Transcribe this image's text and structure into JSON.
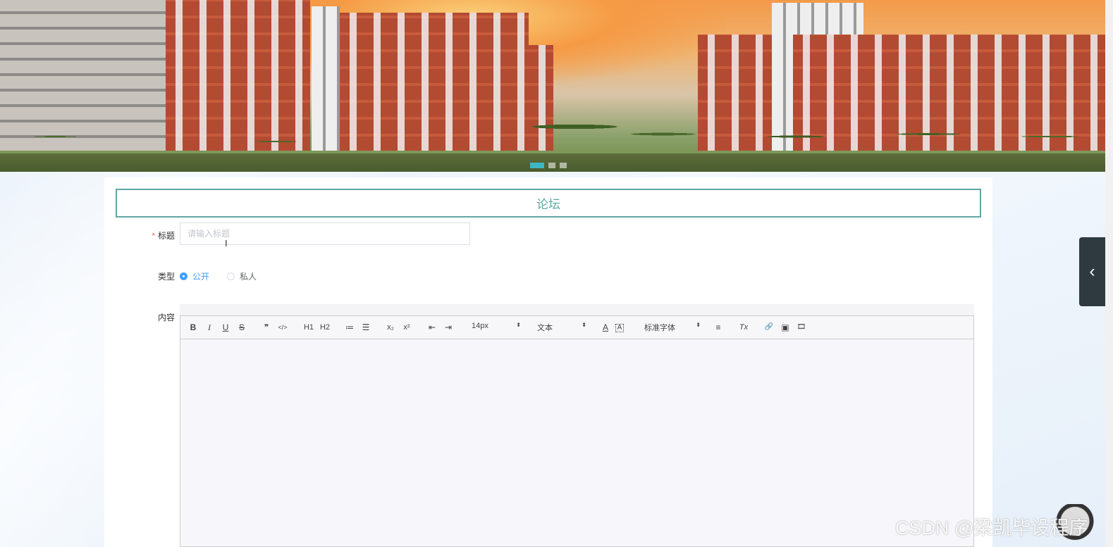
{
  "banner": {
    "carousel_count": 3,
    "active_index": 0
  },
  "form": {
    "title": "论坛",
    "title_field": {
      "required_mark": "*",
      "label": "标题",
      "placeholder": "请输入标题"
    },
    "type_field": {
      "label": "类型",
      "options": [
        "公开",
        "私人"
      ],
      "selected": "公开"
    },
    "content_field": {
      "label": "内容"
    }
  },
  "editor": {
    "toolbar": {
      "bold": "B",
      "italic": "I",
      "underline": "U",
      "strike": "S",
      "blockquote": "❞",
      "code": "</>",
      "h1": "H1",
      "h2": "H2",
      "ordered_list": "≔",
      "bullet_list": "☰",
      "subscript": "x₂",
      "superscript": "x²",
      "outdent": "⇤",
      "indent": "⇥",
      "size_value": "14px",
      "header_value": "文本",
      "font_value": "标准字体",
      "color": "A",
      "background": "A",
      "align": "≡",
      "clean": "Tx",
      "link": "🔗",
      "image": "▣",
      "video": "🎞"
    }
  },
  "watermark": "CSDN @梁凯毕设程序",
  "side_toggle": "‹",
  "colors": {
    "accent_teal": "#5fa7a3",
    "radio_blue": "#409eff",
    "required_red": "#f56c6c",
    "carousel_active": "#3db7c6"
  }
}
